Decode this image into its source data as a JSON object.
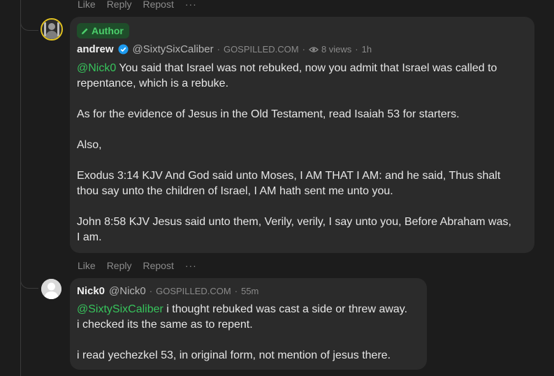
{
  "top_actions": {
    "like": "Like",
    "reply": "Reply",
    "repost": "Repost",
    "more": "···"
  },
  "post1": {
    "badge": "Author",
    "author_name": "andrew",
    "handle": "@SixtySixCaliber",
    "domain": "GOSPILLED.COM",
    "views": "8 views",
    "time": "1h",
    "mention": "@Nick0",
    "text_line1": " You said that Israel was not rebuked, now you admit that Israel was called to\nrepentance, which is a rebuke.",
    "text_rest": "As for the evidence of Jesus in the Old Testament, read Isaiah 53 for starters.\n\nAlso,\n\nExodus 3:14 KJV And God said unto Moses, I AM THAT I AM: and he said, Thus shalt\nthou say unto the children of Israel, I AM hath sent me unto you.\n\nJohn 8:58 KJV Jesus said unto them, Verily, verily, I say unto you, Before Abraham was,\nI am.",
    "actions": {
      "like": "Like",
      "reply": "Reply",
      "repost": "Repost",
      "more": "···"
    }
  },
  "post2": {
    "author_name": "Nick0",
    "handle": "@Nick0",
    "domain": "GOSPILLED.COM",
    "time": "55m",
    "mention": "@SixtySixCaliber",
    "text_line1": " i thought rebuked was cast a side or threw away.",
    "text_rest": "i checked its the same as to repent.\n\ni read yechezkel 53, in original form, not mention of jesus there."
  },
  "colors": {
    "accent_green": "#37c45c",
    "badge_bg": "#1f4d2a",
    "verified_blue": "#1d9bf0",
    "avatar_ring": "#e2c220"
  }
}
